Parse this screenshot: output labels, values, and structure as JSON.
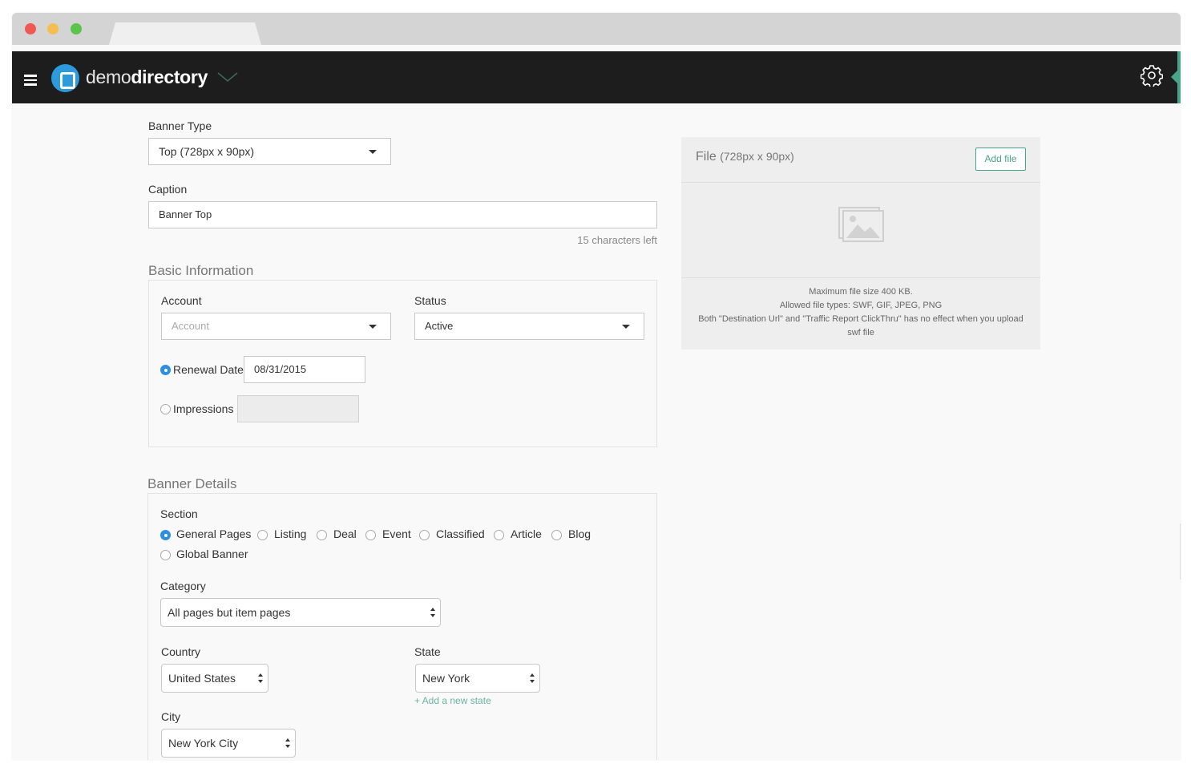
{
  "header": {
    "brand_light": "demo",
    "brand_bold": "directory"
  },
  "banner_type": {
    "label": "Banner Type",
    "value": "Top (728px x 90px)"
  },
  "caption": {
    "label": "Caption",
    "value": "Banner Top",
    "hint": "15 characters left"
  },
  "basic_info": {
    "title": "Basic Information",
    "account_label": "Account",
    "account_placeholder": "Account",
    "status_label": "Status",
    "status_value": "Active",
    "renewal_label": "Renewal Date",
    "renewal_value": "08/31/2015",
    "renewal_selected": true,
    "impressions_label": "Impressions",
    "impressions_value": ""
  },
  "banner_details": {
    "title": "Banner Details",
    "section_label": "Section",
    "sections": [
      {
        "label": "General Pages",
        "checked": true
      },
      {
        "label": "Listing",
        "checked": false
      },
      {
        "label": "Deal",
        "checked": false
      },
      {
        "label": "Event",
        "checked": false
      },
      {
        "label": "Classified",
        "checked": false
      },
      {
        "label": "Article",
        "checked": false
      },
      {
        "label": "Blog",
        "checked": false
      },
      {
        "label": "Global Banner",
        "checked": false
      }
    ],
    "category_label": "Category",
    "category_value": "All pages but item pages",
    "country_label": "Country",
    "country_value": "United States",
    "state_label": "State",
    "state_value": "New York",
    "add_state_link": "+ Add a new state",
    "city_label": "City",
    "city_value": "New York City"
  },
  "file": {
    "title": "File",
    "size_note": "(728px x 90px)",
    "add_button": "Add file",
    "note_1": "Maximum file size 400 KB.",
    "note_2": "Allowed file types: SWF, GIF, JPEG, PNG",
    "note_3": "Both \"Destination Url\" and \"Traffic Report ClickThru\" has no effect when you upload swf file"
  },
  "colors": {
    "navbar": "#1d1d1d",
    "accent_blue": "#2d9bdb",
    "accent_green": "#47a68a"
  }
}
